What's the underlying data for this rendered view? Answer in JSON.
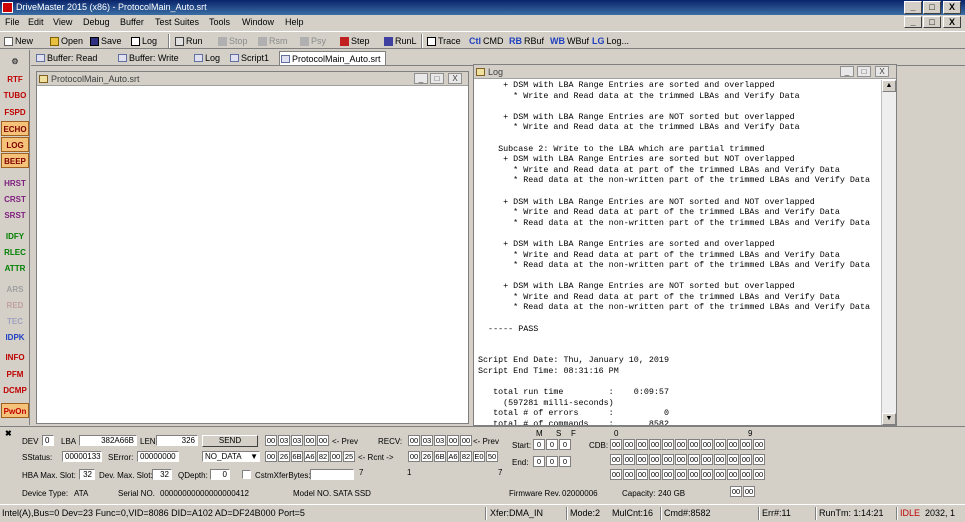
{
  "window": {
    "title": "DriveMaster 2015 (x86) - ProtocolMain_Auto.srt",
    "min": "_",
    "max": "□",
    "close": "X",
    "mdi_min": "_",
    "mdi_restore": "□",
    "mdi_close": "X"
  },
  "menu": [
    "File",
    "Edit",
    "View",
    "Debug",
    "Buffer",
    "Test Suites",
    "Tools",
    "Window",
    "Help"
  ],
  "toolbar": {
    "new": "New",
    "open": "Open",
    "save": "Save",
    "log": "Log",
    "run": "Run",
    "stop": "Stop",
    "pause": "Rsm",
    "resume": "Psy",
    "step": "Step",
    "runl": "RunL",
    "trace": "Trace",
    "cmd_prefix": "Ctl",
    "cmd": "CMD",
    "rbuf_prefix": "RB",
    "rbuf": "RBuf",
    "wbuf_prefix": "WB",
    "wbuf": "WBuf",
    "lg_prefix": "LG",
    "lg": "Log..."
  },
  "side_buttons": [
    "RTF",
    "TUBO",
    "FSPD",
    "ECHO",
    "LOG",
    "BEEP",
    "HRST",
    "CRST",
    "SRST",
    "IDFY",
    "RLEC",
    "ATTR",
    "ARS",
    "RED",
    "TEC",
    "IDPK",
    "INFO",
    "PFM",
    "DCMP",
    "PwOn"
  ],
  "tabs": [
    "Buffer: Read",
    "Buffer: Write",
    "Log",
    "Script1",
    "ProtocolMain_Auto.srt"
  ],
  "editor": {
    "title": "ProtocolMain_Auto.srt"
  },
  "log": {
    "title": "Log",
    "lines": [
      "     + DSM with LBA Range Entries are sorted and overlapped",
      "       * Write and Read data at the trimmed LBAs and Verify Data",
      "",
      "     + DSM with LBA Range Entries are NOT sorted but overlapped",
      "       * Write and Read data at the trimmed LBAs and Verify Data",
      "",
      "    Subcase 2: Write to the LBA which are partial trimmed",
      "     + DSM with LBA Range Entries are sorted but NOT overlapped",
      "       * Write and Read data at part of the trimmed LBAs and Verify Data",
      "       * Read data at the non-written part of the trimmed LBAs and Verify Data",
      "",
      "     + DSM with LBA Range Entries are NOT sorted and NOT overlapped",
      "       * Write and Read data at part of the trimmed LBAs and Verify Data",
      "       * Read data at the non-written part of the trimmed LBAs and Verify Data",
      "",
      "     + DSM with LBA Range Entries are sorted and overlapped",
      "       * Write and Read data at part of the trimmed LBAs and Verify Data",
      "       * Read data at the non-written part of the trimmed LBAs and Verify Data",
      "",
      "     + DSM with LBA Range Entries are NOT sorted but overlapped",
      "       * Write and Read data at part of the trimmed LBAs and Verify Data",
      "       * Read data at the non-written part of the trimmed LBAs and Verify Data",
      "",
      "  ----- PASS",
      "",
      "",
      "Script End Date: Thu, January 10, 2019",
      "Script End Time: 08:31:16 PM",
      "",
      "   total run time         :    0:09:57",
      "     (597281 milli-seconds)",
      "   total # of errors      :          0",
      "   total # of commands    :       8582"
    ]
  },
  "panel": {
    "dev_label": "DEV",
    "dev": "0",
    "lba_label": "LBA",
    "lba": "382A66B",
    "len_label": "LEN",
    "len": "326",
    "send": "SEND",
    "cmd_hex": [
      "00",
      "03",
      "03",
      "00",
      "00"
    ],
    "prev": "<- Prev",
    "recv_label": "RECV:",
    "recv_hex": [
      "00",
      "03",
      "03",
      "00",
      "00"
    ],
    "recv_prev": "<- Prev",
    "sstatus_label": "SStatus:",
    "sstatus": "00000133",
    "serror_label": "SError:",
    "serror": "00000000",
    "nodata": "NO_DATA",
    "hex2": [
      "00",
      "26",
      "6B",
      "A6",
      "82",
      "00",
      "25"
    ],
    "rcnt": "<- Rcnt ->",
    "hex3": [
      "00",
      "26",
      "6B",
      "A6",
      "82",
      "E0",
      "50"
    ],
    "hba_label": "HBA Max. Slot:",
    "hba": "32",
    "devmax_label": "Dev. Max. Slot:",
    "devmax": "32",
    "qdepth_label": "QDepth:",
    "qdepth": "0",
    "cmd_xfer_label": "CstmXferBytes:",
    "n7a": "7",
    "n1": "1",
    "n7b": "7",
    "ms_label": "M",
    "s_label": "S",
    "f_label": "F",
    "start_label": "Start:",
    "start": [
      "0",
      "0",
      "0"
    ],
    "end_label": "End:",
    "end": [
      "0",
      "0",
      "0"
    ],
    "cdb_label": "CDB:",
    "cdb_col0": "0",
    "cdb_col9": "9",
    "cdb_row": [
      "00",
      "00",
      "00",
      "00",
      "00",
      "00",
      "00",
      "00",
      "00",
      "00",
      "00",
      "00"
    ],
    "devtype_label": "Device Type:",
    "devtype": "ATA",
    "serial_label": "Serial NO.",
    "serial": "00000000000000000412",
    "model_label": "Model NO.",
    "model": "SATA SSD",
    "fw_label": "Firmware Rev.",
    "fw": "02000006",
    "cap_label": "Capacity:",
    "cap": "240 GB",
    "last_hex": [
      "00",
      "00"
    ]
  },
  "status": {
    "bus": "Intel(A),Bus=0 Dev=23 Func=0,VID=8086 DID=A102 AD=DF24B000 Port=5",
    "xfer": "Xfer:DMA_IN",
    "mode": "Mode:2",
    "mulcnt": "MulCnt:16",
    "cmd": "Cmd#:8582",
    "err": "Err#:11",
    "runtm": "RunTm: 1:14:21",
    "idle": "IDLE",
    "pos": "2032, 1"
  }
}
